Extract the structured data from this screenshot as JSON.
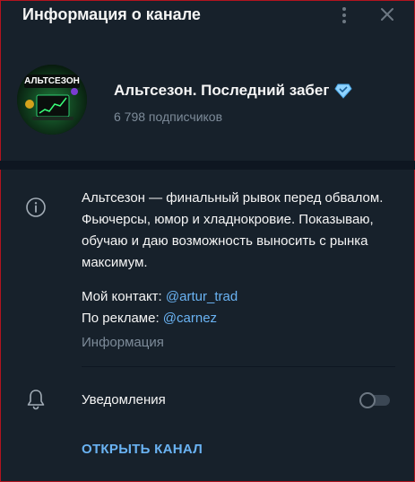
{
  "header": {
    "title": "Информация о канале"
  },
  "channel": {
    "name": "Альтсезон. Последний забег",
    "subscribers": "6 798 подписчиков",
    "avatar_text": "АЛЬТСЕЗОН"
  },
  "info": {
    "description": "Альтсезон — финальный рывок перед обвалом. Фьючерсы, юмор и хладнокровие. Показываю, обучаю и даю возможность выносить с рынка максимум.",
    "contact_prefix": "Мой контакт:",
    "contact_link": "@artur_trad",
    "ads_prefix": "По рекламе:",
    "ads_link": "@carnez",
    "label": "Информация"
  },
  "notifications": {
    "label": "Уведомления",
    "enabled": false
  },
  "actions": {
    "open_channel": "ОТКРЫТЬ КАНАЛ"
  },
  "colors": {
    "background": "#17212b",
    "accent": "#6ab3f3",
    "secondary_text": "#7d8b99",
    "border": "#b3141f"
  },
  "icons": [
    "more-vertical-icon",
    "close-icon",
    "verified-icon",
    "info-icon",
    "bell-icon"
  ]
}
